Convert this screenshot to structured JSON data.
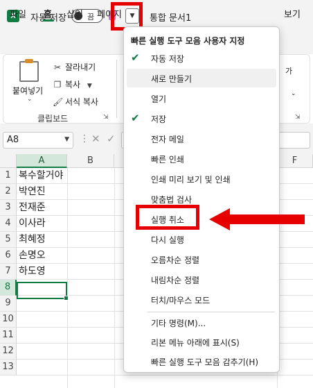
{
  "titlebar": {
    "app_logo": "X",
    "autosave_label": "자동 저장",
    "autosave_toggle": "끔",
    "customize_button_icon": "chevron-down-icon",
    "doc_title": "통합 문서1"
  },
  "tabs": {
    "items": [
      "파일",
      "홈",
      "삽입",
      "페이지",
      "보기"
    ],
    "active": "홈"
  },
  "ribbon": {
    "paste_label": "붙여넣기",
    "cut_label": "잘라내기",
    "copy_label": "복사",
    "format_painter_label": "서식 복사",
    "group_label": "클립보드",
    "partial_right_label": "가"
  },
  "formula_bar": {
    "name_box": "A8",
    "formula": ""
  },
  "grid": {
    "columns": [
      "A",
      "B",
      "F"
    ],
    "selected_column": "A",
    "rows": [
      "1",
      "2",
      "3",
      "4",
      "5",
      "6",
      "7",
      "8",
      "9",
      "10",
      "11",
      "12",
      "13"
    ],
    "selected_row": "8",
    "cells_a": [
      "복수할거야",
      "박연진",
      "전재준",
      "이사라",
      "최혜정",
      "손명오",
      "하도영",
      "",
      "",
      "",
      "",
      "",
      ""
    ],
    "active_cell": "A8"
  },
  "menu": {
    "title": "빠른 실행 도구 모음 사용자 지정",
    "items": [
      {
        "label": "자동 저장",
        "checked": true
      },
      {
        "label": "새로 만들기",
        "checked": false
      },
      {
        "label": "열기",
        "checked": false
      },
      {
        "label": "저장",
        "checked": true
      },
      {
        "label": "전자 메일",
        "checked": false
      },
      {
        "label": "빠른 인쇄",
        "checked": false
      },
      {
        "label": "인쇄 미리 보기 및 인쇄",
        "checked": false
      },
      {
        "label": "맞춤법 검사",
        "checked": false
      },
      {
        "label": "실행 취소",
        "checked": false
      },
      {
        "label": "다시 실행",
        "checked": false
      },
      {
        "label": "오름차순 정렬",
        "checked": false
      },
      {
        "label": "내림차순 정렬",
        "checked": false
      },
      {
        "label": "터치/마우스 모드",
        "checked": false
      },
      {
        "label": "기타 명령(M)...",
        "checked": false
      },
      {
        "label": "리본 메뉴 아래에 표시(S)",
        "checked": false
      },
      {
        "label": "빠른 실행 도구 모음 감추기(H)",
        "checked": false
      }
    ],
    "hovered_item": "새로 만들기",
    "highlighted_item": "실행 취소"
  },
  "colors": {
    "excel_green": "#107c41",
    "annotation_red": "#e60000"
  }
}
